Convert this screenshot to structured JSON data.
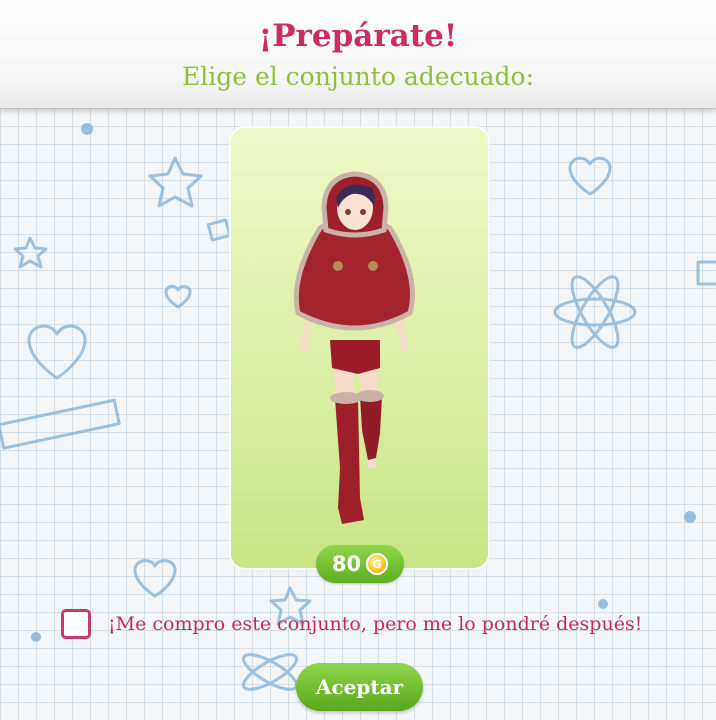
{
  "header": {
    "title": "¡Prepárate!",
    "subtitle": "Elige el conjunto adecuado:"
  },
  "outfit_card": {
    "price": "80",
    "currency_icon": "gold-coin-icon"
  },
  "checkbox": {
    "label": "¡Me compro este conjunto, pero me lo pondré después!",
    "checked": false
  },
  "accept_button": {
    "label": "Aceptar"
  },
  "colors": {
    "title": "#cc2d61",
    "subtitle": "#8fbf3c",
    "button_green": "#6cbd2a",
    "checkbox_border": "#c83a6a"
  }
}
